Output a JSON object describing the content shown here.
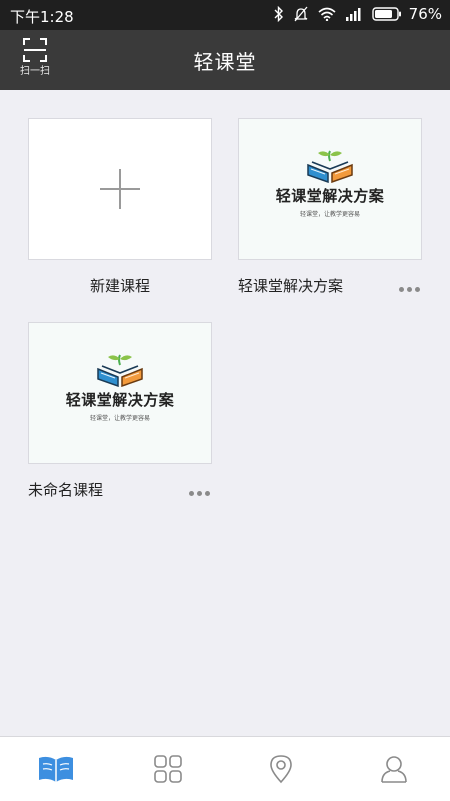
{
  "status_bar": {
    "time": "下午1:28",
    "battery": "76%",
    "icons": [
      "bluetooth-icon",
      "mute-icon",
      "wifi-icon",
      "signal-icon",
      "battery-icon"
    ]
  },
  "header": {
    "scan_label": "扫一扫",
    "scan_icon": "scan-icon",
    "title": "轻课堂"
  },
  "courses": [
    {
      "type": "new",
      "title": "新建课程",
      "icon": "plus-icon"
    },
    {
      "type": "course",
      "title": "轻课堂解决方案",
      "thumb_title": "轻课堂解决方案",
      "thumb_sub": "轻课堂，让教学更容易",
      "more_icon": "more-icon"
    },
    {
      "type": "course",
      "title": "未命名课程",
      "thumb_title": "轻课堂解决方案",
      "thumb_sub": "轻课堂，让教学更容易",
      "more_icon": "more-icon"
    }
  ],
  "bottom_nav": {
    "items": [
      {
        "icon": "book-icon",
        "active": true
      },
      {
        "icon": "grid-icon",
        "active": false
      },
      {
        "icon": "location-icon",
        "active": false
      },
      {
        "icon": "user-icon",
        "active": false
      }
    ]
  },
  "colors": {
    "accent": "#3d8fe0",
    "header_bg": "#3a3a3a",
    "status_bg": "#1f1f1f",
    "page_bg": "#efeff4"
  }
}
